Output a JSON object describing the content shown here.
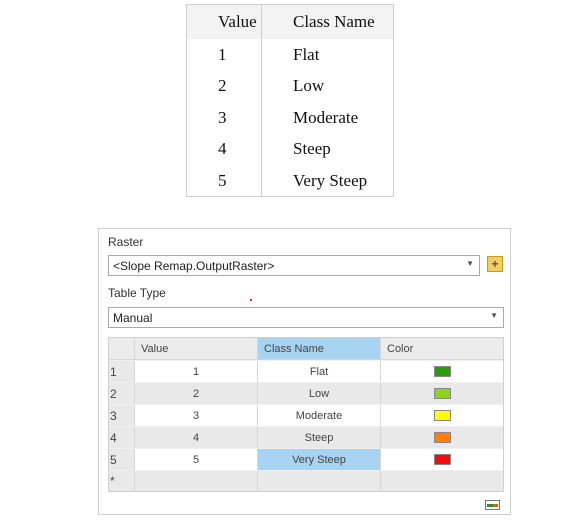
{
  "reference_table": {
    "headers": {
      "value": "Value",
      "class_name": "Class Name"
    },
    "rows": [
      {
        "value": "1",
        "class_name": "Flat"
      },
      {
        "value": "2",
        "class_name": "Low"
      },
      {
        "value": "3",
        "class_name": "Moderate"
      },
      {
        "value": "4",
        "class_name": "Steep"
      },
      {
        "value": "5",
        "class_name": "Very Steep"
      }
    ]
  },
  "panel": {
    "raster_label": "Raster",
    "raster_value": "<Slope Remap.OutputRaster>",
    "table_type_label": "Table Type",
    "table_type_value": "Manual",
    "grid": {
      "headers": {
        "value": "Value",
        "class_name": "Class Name",
        "color": "Color"
      },
      "rows": [
        {
          "row_num": "1",
          "value": "1",
          "class_name": "Flat",
          "color": "#2a9c0e"
        },
        {
          "row_num": "2",
          "value": "2",
          "class_name": "Low",
          "color": "#8fd11c"
        },
        {
          "row_num": "3",
          "value": "3",
          "class_name": "Moderate",
          "color": "#ffff00"
        },
        {
          "row_num": "4",
          "value": "4",
          "class_name": "Steep",
          "color": "#ff7f0a"
        },
        {
          "row_num": "5",
          "value": "5",
          "class_name": "Very Steep",
          "color": "#f20d0d"
        }
      ],
      "new_row_marker": "*"
    }
  },
  "icons": {
    "add_raster": "folder-add-icon",
    "dropdown": "chevron-down-icon",
    "footer": "color-ramp-icon"
  }
}
